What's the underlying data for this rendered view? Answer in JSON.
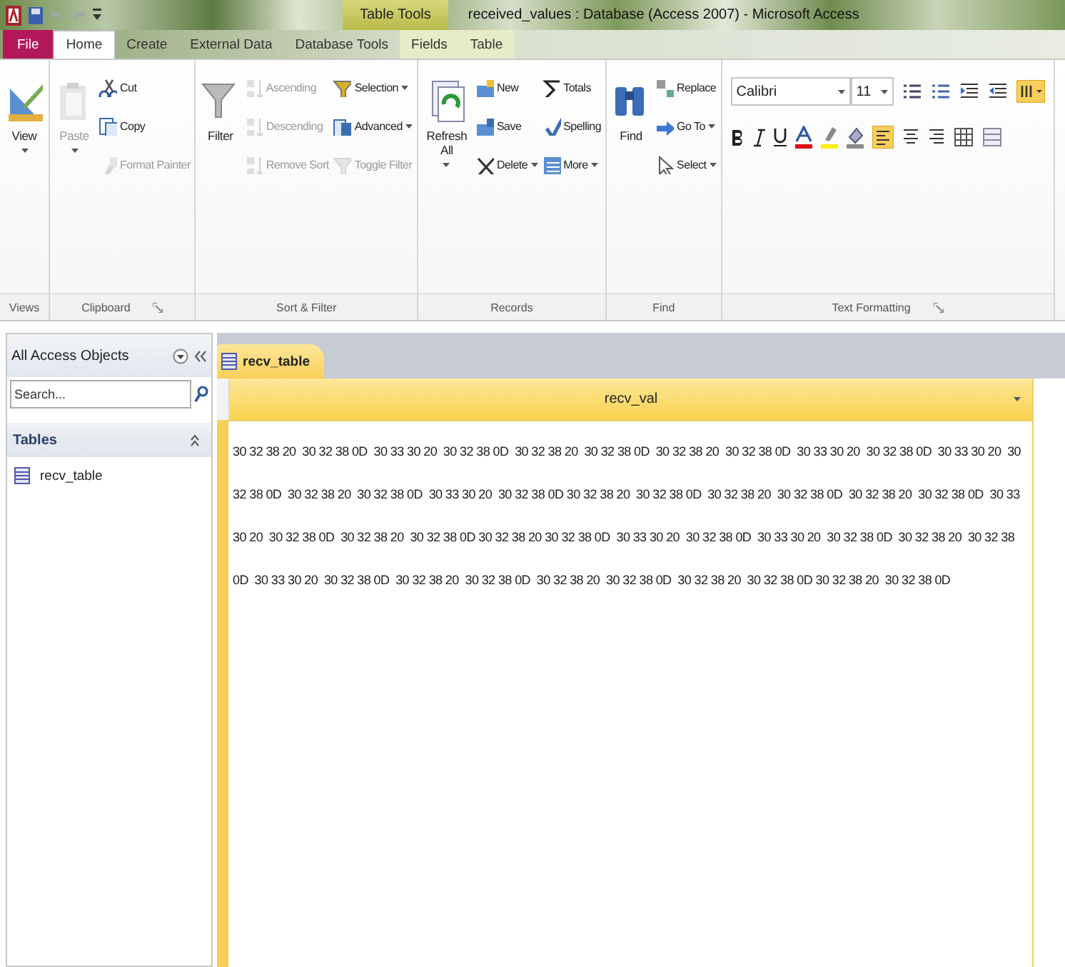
{
  "window": {
    "title": "received_values : Database (Access 2007) - Microsoft Access",
    "contextual_title": "Table Tools"
  },
  "ribbon_tabs": [
    {
      "label": "File",
      "kind": "file",
      "selected": false
    },
    {
      "label": "Home",
      "kind": "tab",
      "selected": true
    },
    {
      "label": "Create",
      "kind": "tab",
      "selected": false
    },
    {
      "label": "External Data",
      "kind": "tab",
      "selected": false
    },
    {
      "label": "Database Tools",
      "kind": "tab",
      "selected": false
    },
    {
      "label": "Fields",
      "kind": "contextual",
      "selected": false
    },
    {
      "label": "Table",
      "kind": "contextual",
      "selected": false
    }
  ],
  "ribbon_groups": [
    {
      "label": "Views",
      "kind": "buttons",
      "launcher": false,
      "items": [
        {
          "label": "View",
          "kind": "large",
          "dropdown": true,
          "disabled": false
        }
      ]
    },
    {
      "label": "Clipboard",
      "kind": "buttons",
      "launcher": true,
      "items": [
        {
          "label": "Paste",
          "kind": "large",
          "dropdown": true,
          "disabled": true
        },
        {
          "label": "Cut",
          "kind": "small",
          "dropdown": false,
          "disabled": false
        },
        {
          "label": "Copy",
          "kind": "small",
          "dropdown": false,
          "disabled": false
        },
        {
          "label": "Format Painter",
          "kind": "small",
          "dropdown": false,
          "disabled": true
        }
      ]
    },
    {
      "label": "Sort & Filter",
      "kind": "buttons",
      "launcher": false,
      "items": [
        {
          "label": "Filter",
          "kind": "large",
          "dropdown": false,
          "disabled": false
        },
        {
          "label": "Ascending",
          "kind": "small",
          "dropdown": false,
          "disabled": true
        },
        {
          "label": "Descending",
          "kind": "small",
          "dropdown": false,
          "disabled": true
        },
        {
          "label": "Remove Sort",
          "kind": "small",
          "dropdown": false,
          "disabled": true
        },
        {
          "label": "Selection",
          "kind": "small",
          "dropdown": true,
          "disabled": false
        },
        {
          "label": "Advanced",
          "kind": "small",
          "dropdown": true,
          "disabled": false
        },
        {
          "label": "Toggle Filter",
          "kind": "small",
          "dropdown": false,
          "disabled": true
        }
      ]
    },
    {
      "label": "Records",
      "kind": "buttons",
      "launcher": false,
      "items": [
        {
          "label": "Refresh All",
          "kind": "large",
          "dropdown": true,
          "disabled": false
        },
        {
          "label": "New",
          "kind": "small",
          "dropdown": false,
          "disabled": false
        },
        {
          "label": "Save",
          "kind": "small",
          "dropdown": false,
          "disabled": false
        },
        {
          "label": "Delete",
          "kind": "small",
          "dropdown": true,
          "disabled": false
        },
        {
          "label": "Totals",
          "kind": "small",
          "dropdown": false,
          "disabled": false
        },
        {
          "label": "Spelling",
          "kind": "small",
          "dropdown": false,
          "disabled": false
        },
        {
          "label": "More",
          "kind": "small",
          "dropdown": true,
          "disabled": false
        }
      ]
    },
    {
      "label": "Find",
      "kind": "buttons",
      "launcher": false,
      "items": [
        {
          "label": "Find",
          "kind": "large",
          "dropdown": false,
          "disabled": false
        },
        {
          "label": "Replace",
          "kind": "small",
          "dropdown": false,
          "disabled": false
        },
        {
          "label": "Go To",
          "kind": "small",
          "dropdown": true,
          "disabled": false
        },
        {
          "label": "Select",
          "kind": "small",
          "dropdown": true,
          "disabled": false
        }
      ]
    },
    {
      "label": "Text Formatting",
      "kind": "format",
      "launcher": true,
      "font": "Calibri",
      "font_size": "11",
      "align_left": true
    }
  ],
  "navigation_pane": {
    "title": "All Access Objects",
    "search": {
      "placeholder": "Search..."
    },
    "groups": [
      {
        "label": "Tables",
        "expanded": true,
        "items": [
          {
            "label": "recv_table",
            "selected": false
          }
        ]
      }
    ]
  },
  "document_tabs": [
    {
      "label": "recv_table",
      "selected": true
    }
  ],
  "table": {
    "columns": [
      "recv_val"
    ],
    "rows": [
      [
        "30 32 38 20  30 32 38 0D  30 33 30 20  30 32 38 0D  30 32 38 20  30 32 38 0D  30 32 38 20  30 32 38 0D  30 33 30 20  30 32 38 0D  30 33 30 20  30 32 38 0D  30 32 38 20  30 32 38 0D  30 33 30 20  30 32 38 0D 30 32 38 20  30 32 38 0D  30 32 38 20  30 32 38 0D  30 32 38 20  30 32 38 0D  30 33 30 20  30 32 38 0D  30 32 38 20  30 32 38 0D 30 32 38 20 30 32 38 0D  30 33 30 20  30 32 38 0D  30 33 30 20  30 32 38 0D  30 32 38 20  30 32 38 0D  30 33 30 20  30 32 38 0D  30 32 38 20  30 32 38 0D  30 32 38 20  30 32 38 0D  30 32 38 20  30 32 38 0D 30 32 38 20  30 32 38 0D"
      ]
    ]
  }
}
